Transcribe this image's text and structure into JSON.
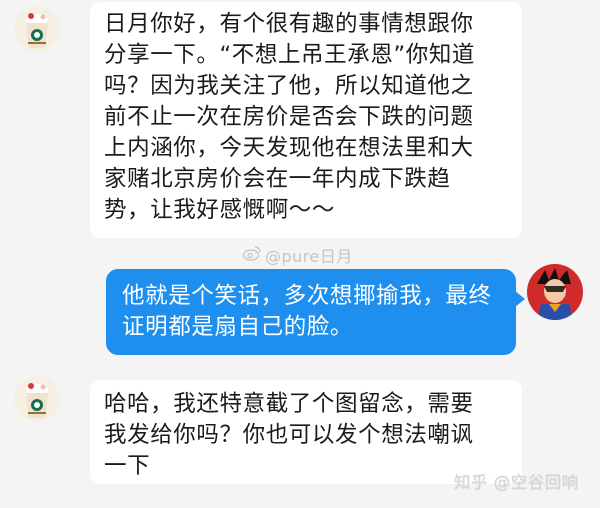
{
  "messages": [
    {
      "side": "left",
      "lines": [
        "日月你好，有个很有趣的事情想跟你",
        "分享一下。“不想上吊王承恩”你知道",
        "吗？因为我关注了他，所以知道他之",
        "前不止一次在房价是否会下跌的问题",
        "上内涵你，今天发现他在想法里和大",
        "家赌北京房价会在一年内成下跌趋",
        "势，让我好感慨啊～～"
      ]
    },
    {
      "side": "right",
      "lines": [
        "他就是个笑话，多次想揶揄我，最终",
        "证明都是扇自己的脸。"
      ]
    },
    {
      "side": "left",
      "lines": [
        "哈哈，我还特意截了个图留念，需要",
        "我发给你吗？你也可以发个想法嘲讽",
        "一下"
      ]
    }
  ],
  "watermark": {
    "icon": "weibo-icon",
    "text": "@pure日月"
  },
  "zhihu_watermark": "知乎 @空谷回响",
  "colors": {
    "background": "#f4f4f4",
    "outgoing_bubble": "#1f8fef",
    "incoming_bubble": "#ffffff"
  }
}
